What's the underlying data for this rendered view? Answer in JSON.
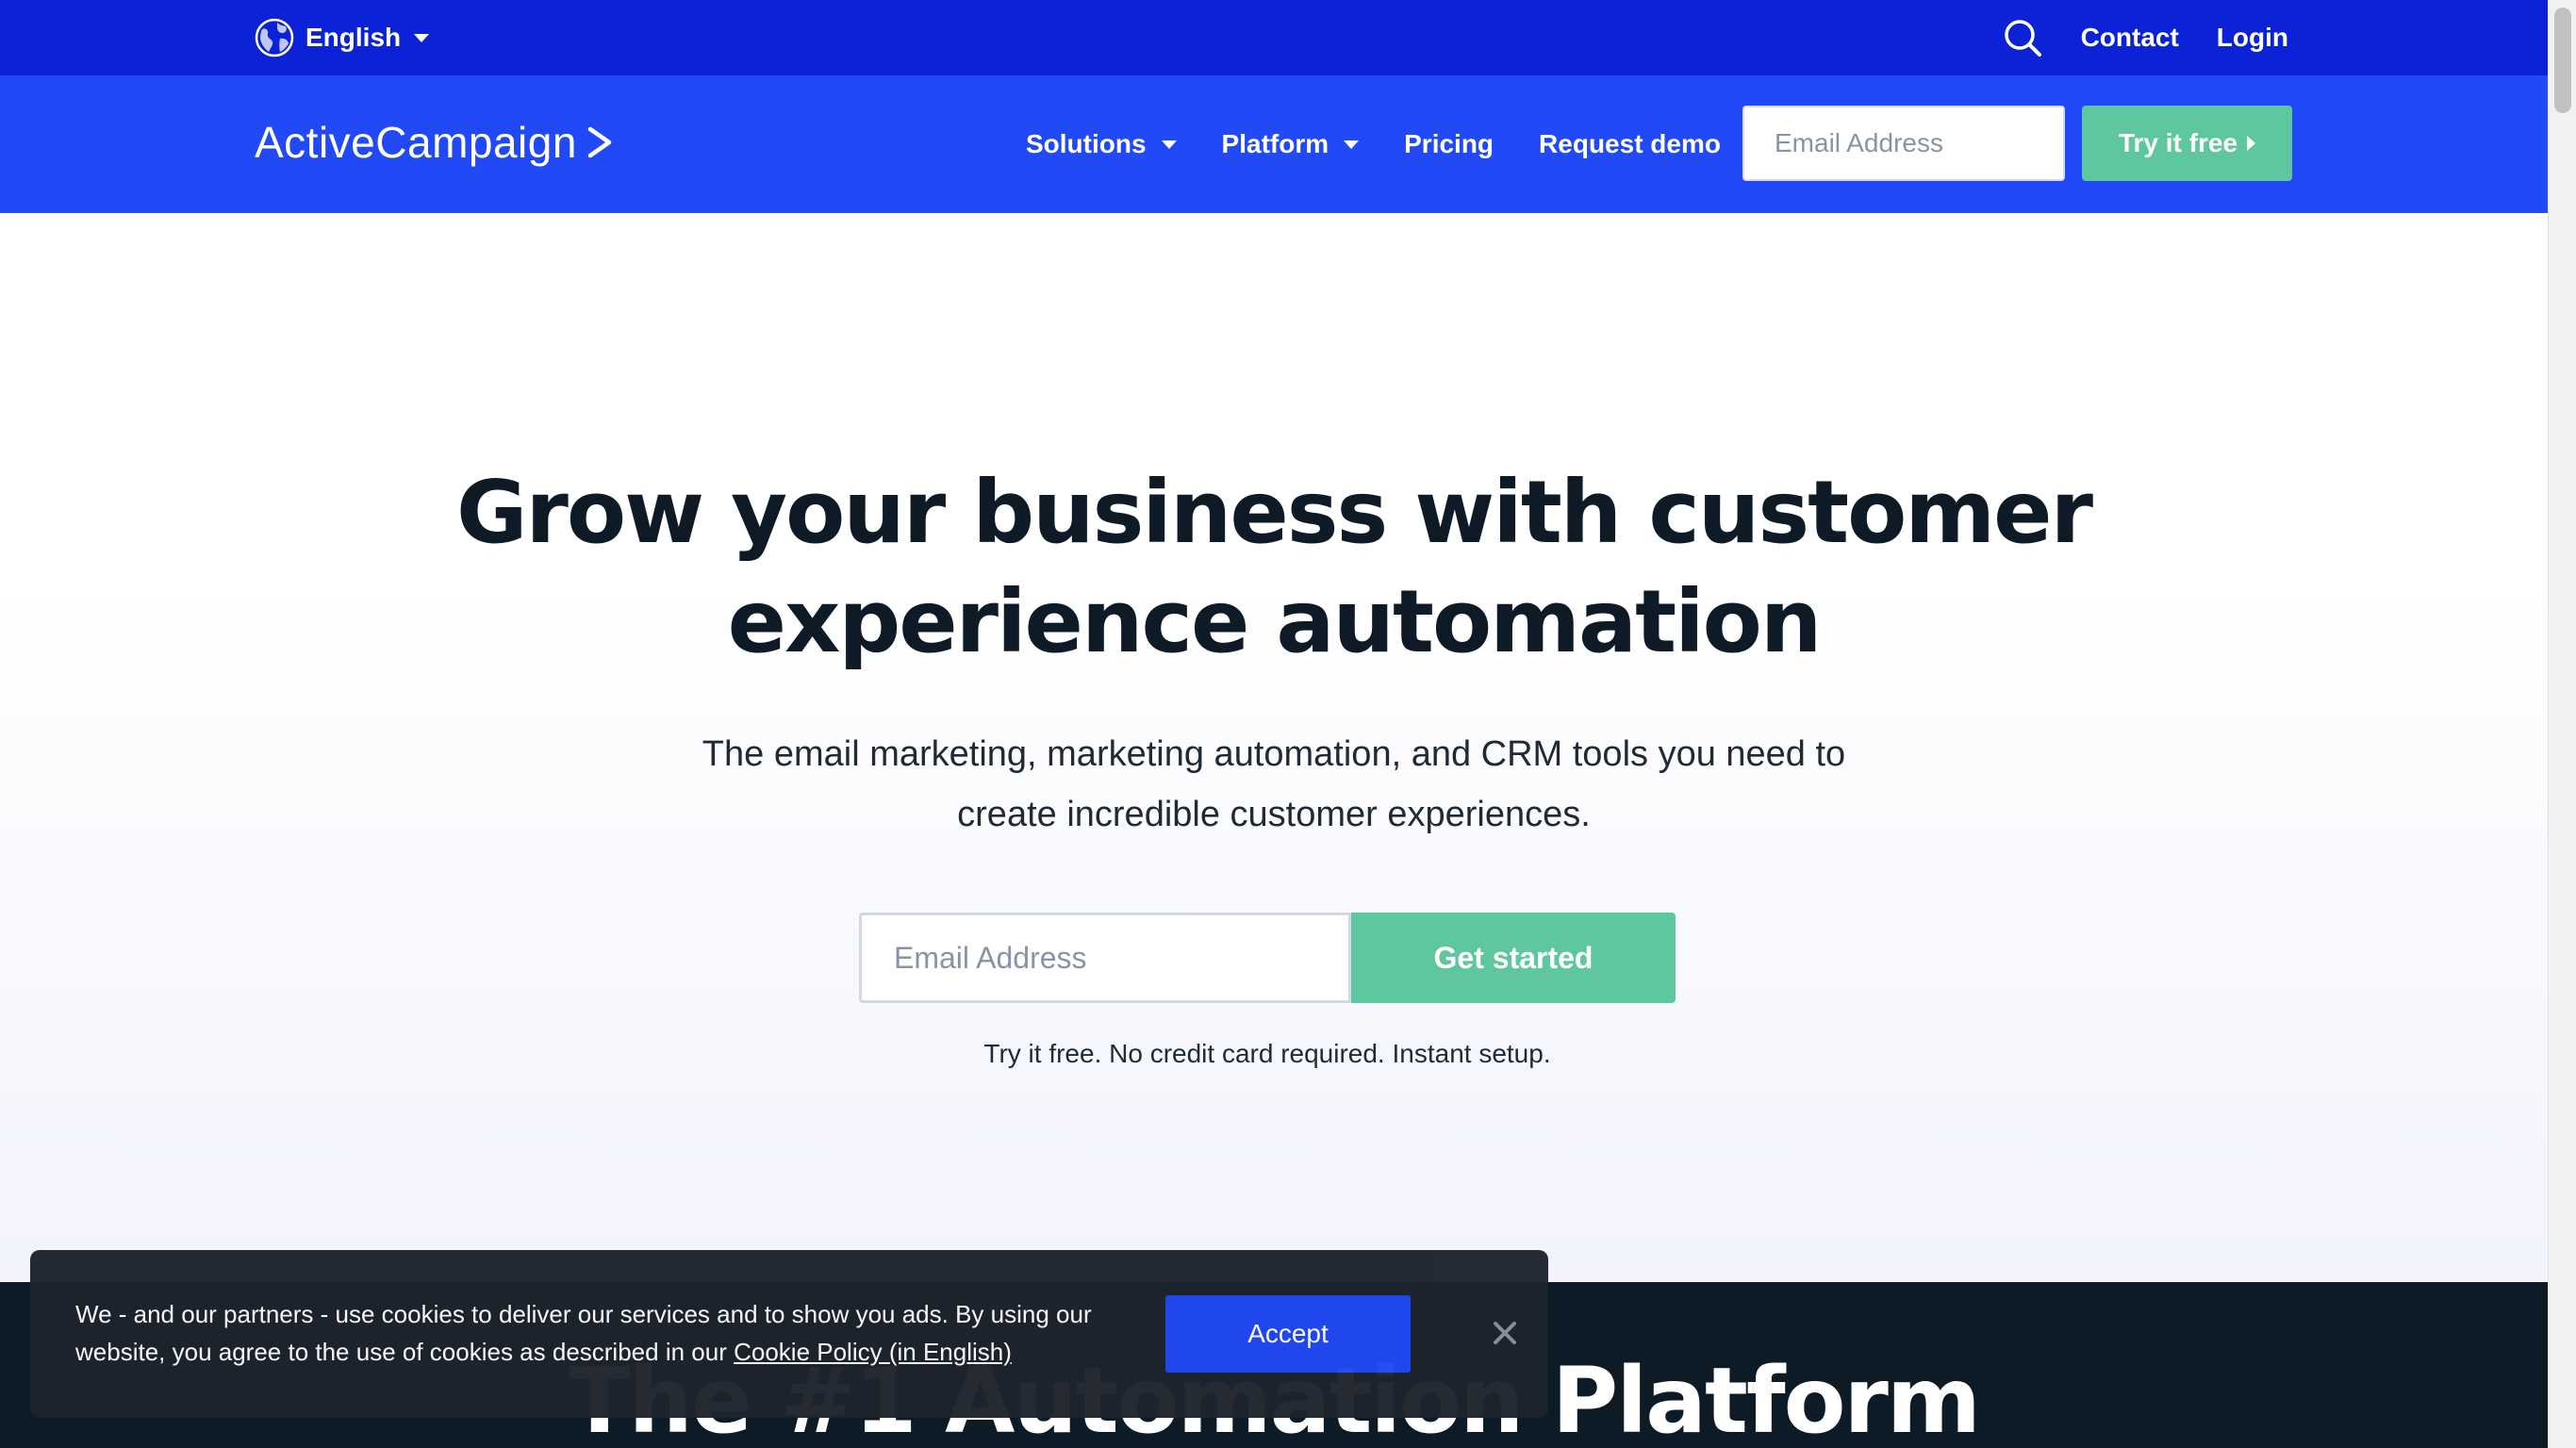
{
  "utility": {
    "language": "English",
    "contact": "Contact",
    "login": "Login"
  },
  "nav": {
    "logo": "ActiveCampaign",
    "items": [
      {
        "label": "Solutions"
      },
      {
        "label": "Platform"
      },
      {
        "label": "Pricing"
      },
      {
        "label": "Request demo"
      }
    ],
    "email_placeholder": "Email Address",
    "cta": "Try it free"
  },
  "hero": {
    "title_line1": "Grow your business with customer",
    "title_line2": "experience automation",
    "subtitle_line1": "The email marketing, marketing automation, and CRM tools you need to",
    "subtitle_line2": "create incredible customer experiences.",
    "email_placeholder": "Email Address",
    "cta": "Get started",
    "note": "Try it free. No credit card required. Instant setup."
  },
  "section2": {
    "title": "The #1 Automation Platform"
  },
  "cookie": {
    "text": "We - and our partners - use cookies to deliver our services and to show you ads. By using our website, you agree to the use of cookies as described in our",
    "link": "Cookie Policy (in English)",
    "accept": "Accept"
  },
  "colors": {
    "utility_bar": "#0b22d6",
    "nav_bar": "#2149f5",
    "cta_green": "#5fc79f",
    "dark_navy": "#0d1b27"
  }
}
